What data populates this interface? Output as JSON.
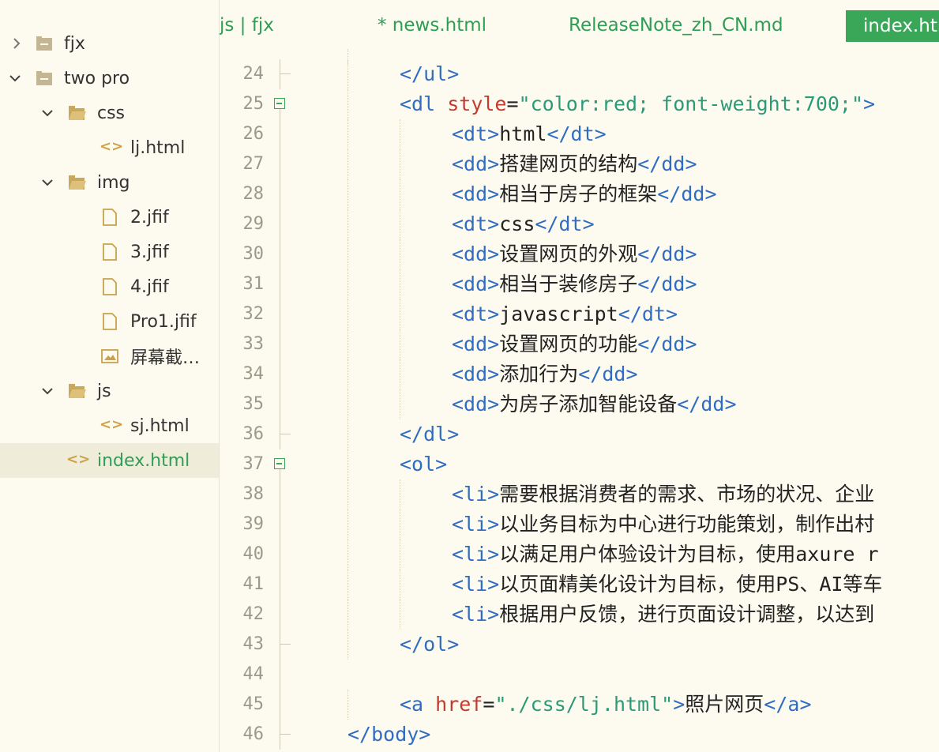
{
  "sidebar": {
    "items": [
      {
        "label": "fjx",
        "type": "folder",
        "state": "collapsed",
        "icon": "folder-closed-icon"
      },
      {
        "label": "two pro",
        "type": "folder",
        "state": "expanded",
        "icon": "folder-closed-icon"
      },
      {
        "label": "css",
        "type": "folder",
        "state": "expanded",
        "icon": "folder-open-icon"
      },
      {
        "label": "lj.html",
        "type": "file",
        "icon": "code-file-icon"
      },
      {
        "label": "img",
        "type": "folder",
        "state": "expanded",
        "icon": "folder-open-icon"
      },
      {
        "label": "2.jfif",
        "type": "file",
        "icon": "file-icon"
      },
      {
        "label": "3.jfif",
        "type": "file",
        "icon": "file-icon"
      },
      {
        "label": "4.jfif",
        "type": "file",
        "icon": "file-icon"
      },
      {
        "label": "Pro1.jfif",
        "type": "file",
        "icon": "file-icon"
      },
      {
        "label": "屏幕截…",
        "type": "file",
        "icon": "image-file-icon"
      },
      {
        "label": "js",
        "type": "folder",
        "state": "expanded",
        "icon": "folder-open-icon"
      },
      {
        "label": "sj.html",
        "type": "file",
        "icon": "code-file-icon"
      },
      {
        "label": "index.html",
        "type": "file",
        "icon": "code-file-icon",
        "selected": true
      }
    ],
    "code_glyph": "<>"
  },
  "tabs": [
    {
      "label": "js | fjx"
    },
    {
      "label": "* news.html"
    },
    {
      "label": "ReleaseNote_zh_CN.md"
    },
    {
      "label": "index.html",
      "active": true
    }
  ],
  "editor": {
    "lines": [
      {
        "n": "24",
        "t1": "</ul>"
      },
      {
        "n": "25",
        "t1": "<dl ",
        "a1": "style",
        "e1": "=",
        "v1": "\"color:red; font-weight:700;\"",
        "t2": ">"
      },
      {
        "n": "26",
        "t1": "<dt>",
        "x": "html",
        "t2": "</dt>"
      },
      {
        "n": "27",
        "t1": "<dd>",
        "x": "搭建网页的结构",
        "t2": "</dd>"
      },
      {
        "n": "28",
        "t1": "<dd>",
        "x": "相当于房子的框架",
        "t2": "</dd>"
      },
      {
        "n": "29",
        "t1": "<dt>",
        "x": "css",
        "t2": "</dt>"
      },
      {
        "n": "30",
        "t1": "<dd>",
        "x": "设置网页的外观",
        "t2": "</dd>"
      },
      {
        "n": "31",
        "t1": "<dd>",
        "x": "相当于装修房子",
        "t2": "</dd>"
      },
      {
        "n": "32",
        "t1": "<dt>",
        "x": "javascript",
        "t2": "</dt>"
      },
      {
        "n": "33",
        "t1": "<dd>",
        "x": "设置网页的功能",
        "t2": "</dd>"
      },
      {
        "n": "34",
        "t1": "<dd>",
        "x": "添加行为",
        "t2": "</dd>"
      },
      {
        "n": "35",
        "t1": "<dd>",
        "x": "为房子添加智能设备",
        "t2": "</dd>"
      },
      {
        "n": "36",
        "t1": "</dl>"
      },
      {
        "n": "37",
        "t1": "<ol>"
      },
      {
        "n": "38",
        "t1": "<li>",
        "x": "需要根据消费者的需求、市场的状况、企业"
      },
      {
        "n": "39",
        "t1": "<li>",
        "x": "以业务目标为中心进行功能策划，制作出村"
      },
      {
        "n": "40",
        "t1": "<li>",
        "x": "以满足用户体验设计为目标，使用axure r"
      },
      {
        "n": "41",
        "t1": "<li>",
        "x": "以页面精美化设计为目标，使用PS、AI等车"
      },
      {
        "n": "42",
        "t1": "<li>",
        "x": "根据用户反馈，进行页面设计调整，以达到"
      },
      {
        "n": "43",
        "t1": "</ol>"
      },
      {
        "n": "44"
      },
      {
        "n": "45",
        "t1": "<a ",
        "a1": "href",
        "e1": "=",
        "v1": "\"./css/lj.html\"",
        "t2": ">",
        "x": "照片网页",
        "t3": "</a>"
      },
      {
        "n": "46",
        "t1": "</body>"
      }
    ]
  },
  "colors": {
    "accent": "#3aa657",
    "tag": "#2f6dc4",
    "attribute": "#c43a2f",
    "value": "#2a9a78",
    "background": "#fdfbef"
  }
}
